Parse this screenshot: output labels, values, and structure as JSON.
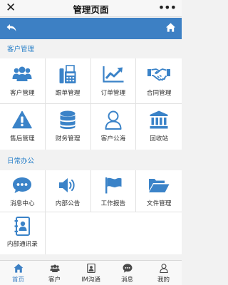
{
  "titlebar": {
    "close_glyph": "✕",
    "title": "管理页面",
    "more_glyph": "•••"
  },
  "navbar": {
    "back_icon": "back-arrow-icon",
    "home_icon": "home-icon",
    "color": "#3d80c4"
  },
  "sections": [
    {
      "title": "客户管理",
      "items": [
        {
          "label": "客户管理",
          "icon": "users-icon"
        },
        {
          "label": "跟单管理",
          "icon": "fax-icon"
        },
        {
          "label": "订单管理",
          "icon": "line-chart-icon"
        },
        {
          "label": "合同管理",
          "icon": "handshake-icon"
        },
        {
          "label": "售后管理",
          "icon": "warning-icon"
        },
        {
          "label": "财务管理",
          "icon": "database-icon"
        },
        {
          "label": "客户公海",
          "icon": "user-outline-icon"
        },
        {
          "label": "回收站",
          "icon": "bank-icon"
        }
      ]
    },
    {
      "title": "日常办公",
      "items": [
        {
          "label": "消息中心",
          "icon": "chat-icon"
        },
        {
          "label": "内部公告",
          "icon": "volume-icon"
        },
        {
          "label": "工作报告",
          "icon": "flag-icon"
        },
        {
          "label": "文件管理",
          "icon": "folder-open-icon"
        },
        {
          "label": "内部通讯录",
          "icon": "contact-book-icon"
        }
      ]
    }
  ],
  "tabbar": [
    {
      "label": "首页",
      "icon": "home-icon",
      "active": true
    },
    {
      "label": "客户",
      "icon": "users-icon",
      "active": false
    },
    {
      "label": "IM沟通",
      "icon": "im-icon",
      "active": false
    },
    {
      "label": "消息",
      "icon": "chat-icon",
      "active": false
    },
    {
      "label": "我的",
      "icon": "user-outline-icon",
      "active": false
    }
  ],
  "colors": {
    "accent": "#3d80c4",
    "icon_blue": "#3b83c8",
    "section_text": "#2c82c9"
  }
}
